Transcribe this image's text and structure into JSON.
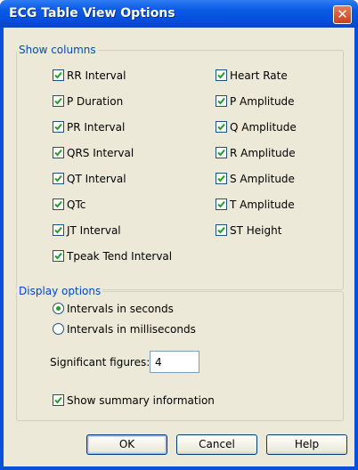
{
  "window": {
    "title": "ECG Table View Options",
    "close_icon": "close-icon"
  },
  "show_columns": {
    "title": "Show columns",
    "left": [
      {
        "label": "RR Interval",
        "checked": true
      },
      {
        "label": "P Duration",
        "checked": true
      },
      {
        "label": "PR Interval",
        "checked": true
      },
      {
        "label": "QRS Interval",
        "checked": true
      },
      {
        "label": "QT Interval",
        "checked": true
      },
      {
        "label": "QTc",
        "checked": true
      },
      {
        "label": "JT Interval",
        "checked": true
      },
      {
        "label": "Tpeak Tend Interval",
        "checked": true
      }
    ],
    "right": [
      {
        "label": "Heart Rate",
        "checked": true
      },
      {
        "label": "P Amplitude",
        "checked": true
      },
      {
        "label": "Q Amplitude",
        "checked": true
      },
      {
        "label": "R Amplitude",
        "checked": true
      },
      {
        "label": "S Amplitude",
        "checked": true
      },
      {
        "label": "T Amplitude",
        "checked": true
      },
      {
        "label": "ST Height",
        "checked": true
      }
    ]
  },
  "display_options": {
    "title": "Display options",
    "radio_seconds": {
      "label": "Intervals in seconds",
      "selected": true
    },
    "radio_ms": {
      "label": "Intervals in milliseconds",
      "selected": false
    },
    "sig_fig_label": "Significant figures:",
    "sig_fig_value": "4",
    "summary": {
      "label": "Show summary information",
      "checked": true
    }
  },
  "buttons": {
    "ok": "OK",
    "cancel": "Cancel",
    "help": "Help"
  },
  "colors": {
    "title_bar": "#0b5be6",
    "group_title": "#0046d5",
    "check": "#21a121",
    "face": "#ece9d8"
  }
}
